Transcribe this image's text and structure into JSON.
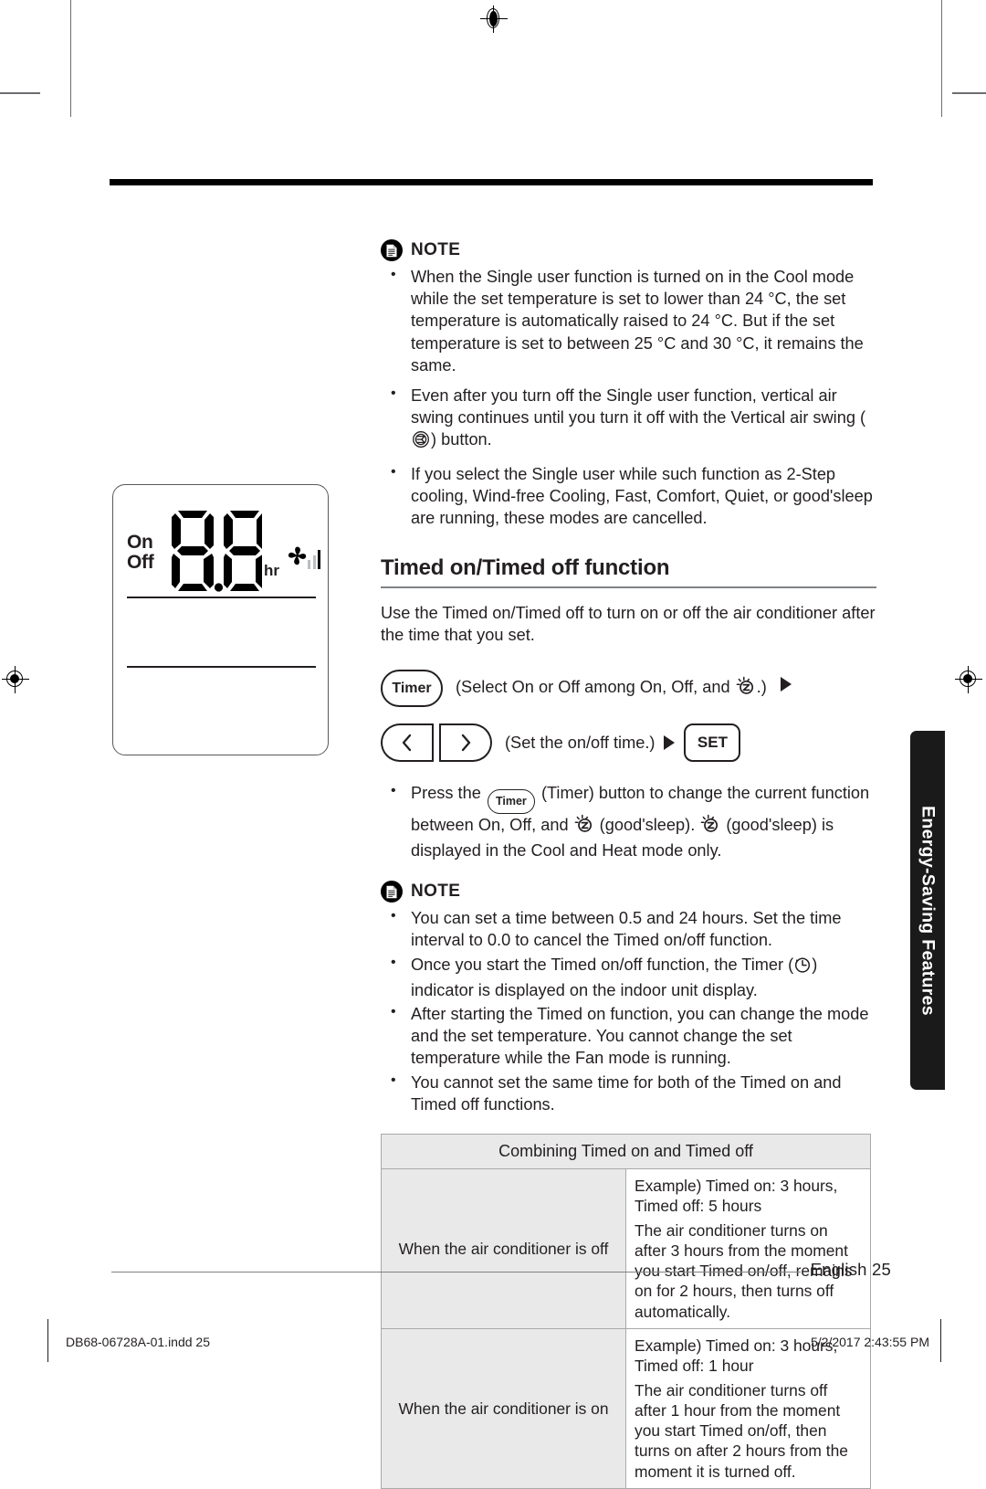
{
  "page": {
    "footer_label": "English  25",
    "print_filename": "DB68-06728A-01.indd   25",
    "print_timestamp": "5/2/2017   2:43:55 PM"
  },
  "side_tab": {
    "label": "Energy-Saving Features"
  },
  "illustration": {
    "name": "indoor-unit-display",
    "on_label": "On",
    "off_label": "Off",
    "digits": "8.8",
    "unit": "hr",
    "fan_icon": "fan-icon",
    "signal_icon": "signal-bars-icon"
  },
  "note_top": {
    "label": "NOTE",
    "icon": "note-document-icon",
    "bullets": [
      "When the Single user function is turned on in the Cool mode while the set temperature is set to lower than 24 °C, the set temperature is automatically raised to 24 °C. But if the set temperature is set to between 25 °C and 30 °C, it remains the same.",
      "Even after you turn off the Single user function, vertical air swing continues until you turn it off with the Vertical air swing (",
      ") button.",
      "If you select the Single user while such function as 2-Step cooling, Wind-free Cooling, Fast, Comfort, Quiet, or good'sleep are running, these modes are cancelled."
    ]
  },
  "section": {
    "title": "Timed on/Timed off function",
    "intro": "Use the Timed on/Timed off to turn on or off the air conditioner after the time that you set."
  },
  "steps": {
    "timer_button_label": "Timer",
    "step1_caption_a": "(Select On or Off among On, Off, and ",
    "step1_caption_b": ".)",
    "goodsleep_icon": "goodsleep-icon",
    "arrow_left_icon": "chevron-left-icon",
    "arrow_right_icon": "chevron-right-icon",
    "step2_caption": "(Set the on/off time.)",
    "set_button_label": "SET"
  },
  "press_note": {
    "part1": "Press the ",
    "timer_label": "Timer",
    "part2": " (Timer) button to change the current function between On, Off, and ",
    "part3": " (good'sleep). ",
    "part4": " (good'sleep) is displayed in the Cool and Heat mode only."
  },
  "note_bottom": {
    "label": "NOTE",
    "icon": "note-document-icon",
    "bullets": [
      "You can set a time between 0.5 and 24 hours. Set the time interval to 0.0 to cancel the Timed on/off function.",
      "Once you start the Timed on/off function, the Timer (",
      ") indicator is displayed on the indoor unit display.",
      "After starting the Timed on function, you can change the mode and the set temperature. You cannot change the set temperature while the Fan mode is running.",
      "You cannot set the same time for both of the Timed on and Timed off functions."
    ],
    "timer_indicator_icon": "clock-icon"
  },
  "table": {
    "header": "Combining Timed on and Timed off",
    "rows": [
      {
        "head": "When the air conditioner is off",
        "example": "Example) Timed on: 3 hours, Timed off: 5 hours",
        "detail": "The air conditioner turns on after 3 hours from the moment you start Timed on/off, remains on for 2 hours, then turns off automatically."
      },
      {
        "head": "When the air conditioner is on",
        "example": "Example) Timed on: 3 hours, Timed off: 1 hour",
        "detail": "The air conditioner turns off after 1 hour from the moment you start Timed on/off, then turns on after 2 hours from the moment it is turned off."
      }
    ]
  },
  "colors": {
    "text": "#231f20",
    "rule": "#808285",
    "table_shade": "#e9e9e9",
    "tab_bg": "#1a1a1a"
  }
}
